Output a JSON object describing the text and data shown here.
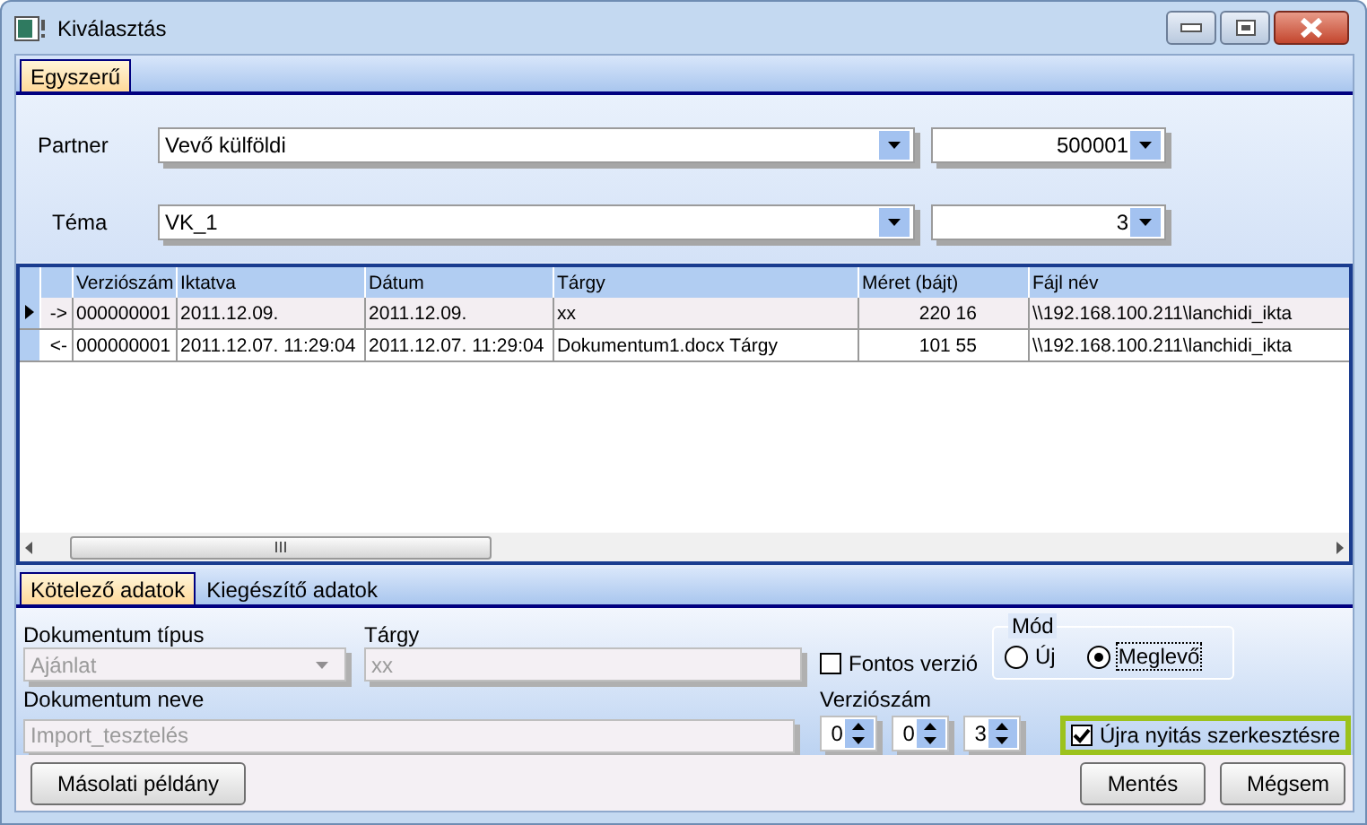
{
  "window": {
    "title": "Kiválasztás"
  },
  "tabs": [
    {
      "label": "Egyszerű",
      "selected": true
    }
  ],
  "partner": {
    "label": "Partner",
    "value": "Vevő külföldi",
    "code": "500001"
  },
  "topic": {
    "label": "Téma",
    "value": "VK_1",
    "code": "3"
  },
  "table": {
    "columns": [
      "Verziószám",
      "Iktatva",
      "Dátum",
      "Tárgy",
      "Méret (bájt)",
      "Fájl név"
    ],
    "rows": [
      {
        "selected": true,
        "direction": "->",
        "cells": [
          "000000001",
          "2011.12.09.",
          "2011.12.09.",
          "xx",
          "220 16",
          "\\\\192.168.100.211\\lanchidi_ikta"
        ]
      },
      {
        "selected": false,
        "direction": "<-",
        "cells": [
          "000000001",
          "2011.12.07. 11:29:04",
          "2011.12.07. 11:29:04",
          "Dokumentum1.docx Tárgy",
          "101 55",
          "\\\\192.168.100.211\\lanchidi_ikta"
        ]
      }
    ]
  },
  "detail_tabs": [
    {
      "label": "Kötelező adatok",
      "selected": true
    },
    {
      "label": "Kiegészítő adatok",
      "selected": false
    }
  ],
  "document_type": {
    "label": "Dokumentum típus",
    "value": "Ajánlat",
    "disabled": true
  },
  "subject": {
    "label": "Tárgy",
    "value": "xx",
    "disabled": true
  },
  "important_version": {
    "label": "Fontos verzió",
    "checked": false
  },
  "mode": {
    "label": "Mód",
    "options": [
      {
        "label": "Új",
        "selected": false
      },
      {
        "label": "Meglevő",
        "selected": true
      }
    ]
  },
  "document_name": {
    "label": "Dokumentum neve",
    "value": "Import_tesztelés",
    "disabled": true
  },
  "version": {
    "label": "Verziószám",
    "parts": [
      "0",
      "0",
      "3"
    ]
  },
  "reopen": {
    "label": "Újra nyitás szerkesztésre",
    "checked": true
  },
  "buttons": {
    "left": [
      "Másolati példány"
    ],
    "right": [
      "Mentés",
      "Mégsem"
    ]
  }
}
